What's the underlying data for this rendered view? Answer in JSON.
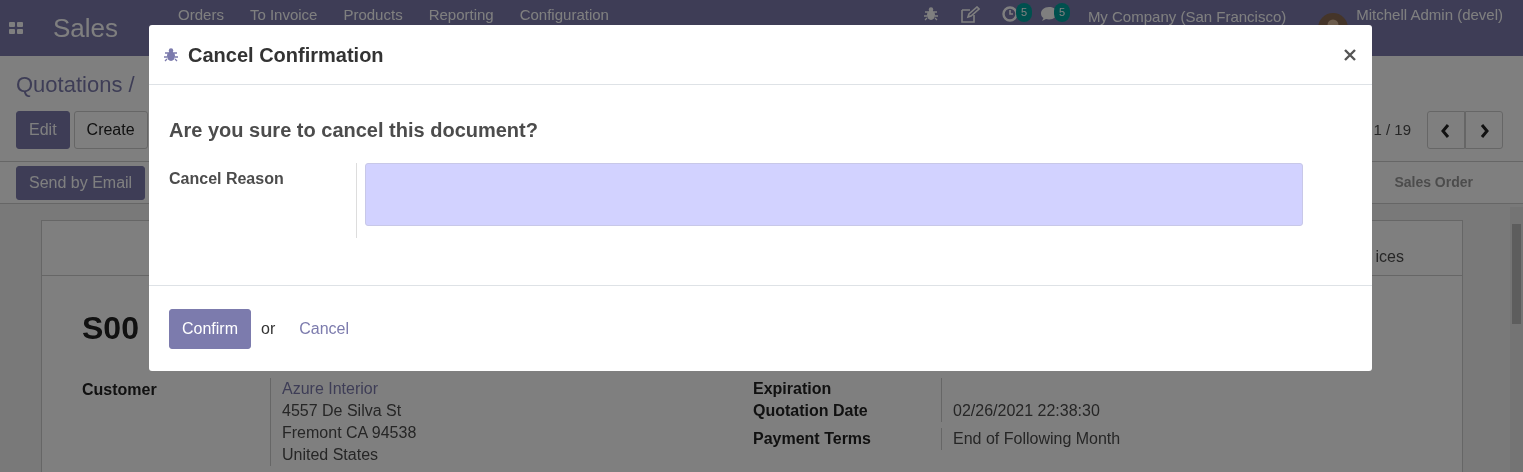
{
  "navbar": {
    "app": "Sales",
    "menu": [
      "Orders",
      "To Invoice",
      "Products",
      "Reporting",
      "Configuration"
    ],
    "activity_count": "5",
    "message_count": "5",
    "company": "My Company (San Francisco)",
    "user": "Mitchell Admin (devel)"
  },
  "breadcrumb": "Quotations /",
  "actions": [
    "Edit",
    "Create"
  ],
  "pager": "1 / 19",
  "header_buttons": [
    "Send by Email"
  ],
  "statusbar": [
    "Sales Order"
  ],
  "smart_button": "ices",
  "record": {
    "name": "S00",
    "customer_label": "Customer",
    "customer": "Azure Interior",
    "address": [
      "4557 De Silva St",
      "Fremont CA 94538",
      "United States"
    ],
    "fields": [
      {
        "label": "Expiration"
      },
      {
        "label": "Quotation Date",
        "value": "02/26/2021 22:38:30"
      },
      {
        "label": "Payment Terms",
        "value": "End of Following Month"
      }
    ]
  },
  "dialog": {
    "title": "Cancel Confirmation",
    "question": "Are you sure to cancel this document?",
    "field_label": "Cancel Reason",
    "confirm": "Confirm",
    "or": "or",
    "cancel": "Cancel"
  }
}
